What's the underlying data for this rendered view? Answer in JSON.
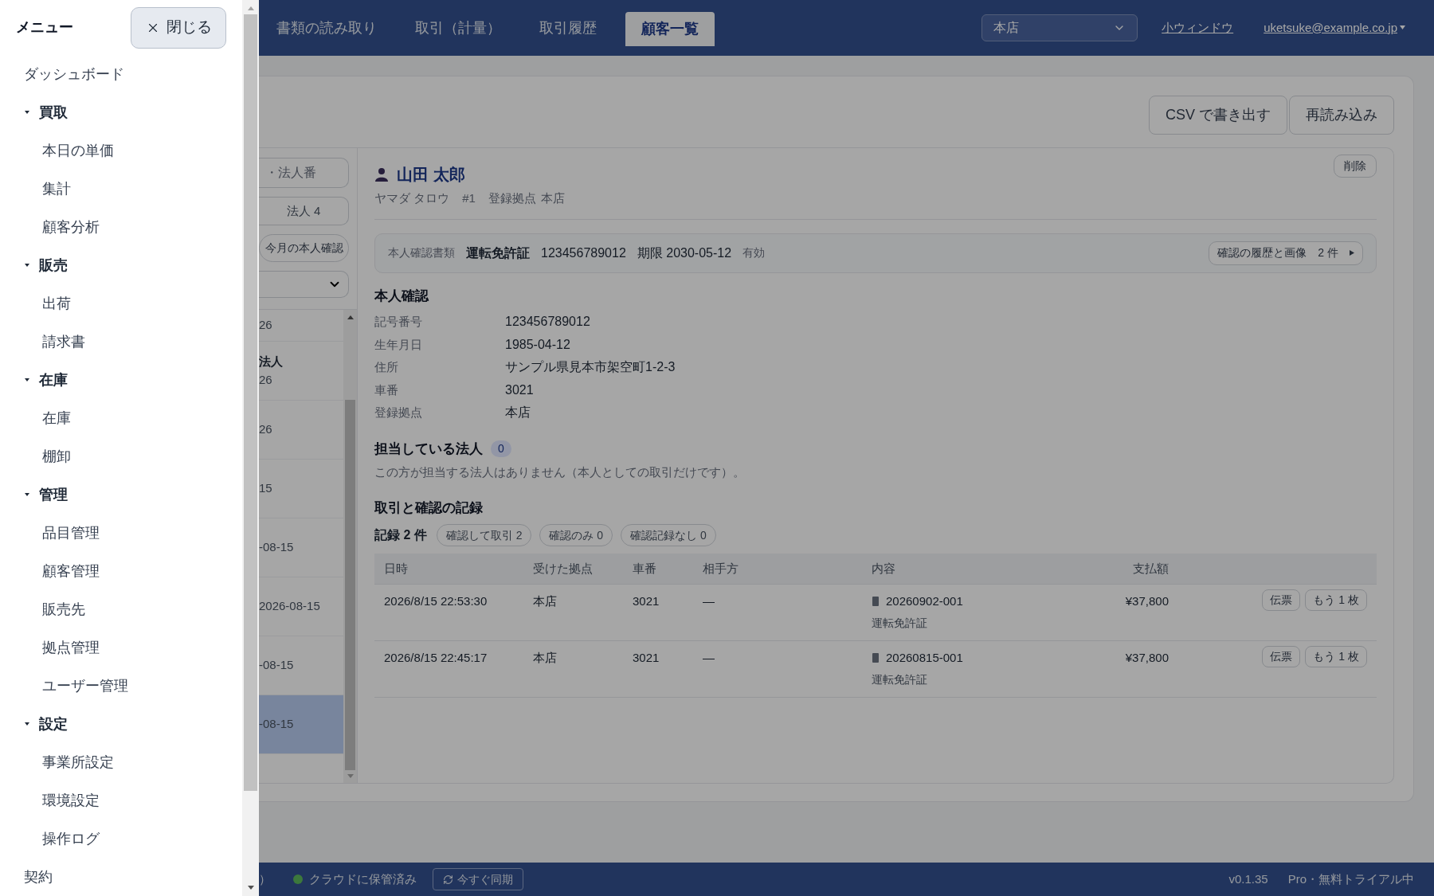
{
  "menu": {
    "title": "メニュー",
    "close_label": "閉じる",
    "items": [
      {
        "label": "ダッシュボード"
      },
      {
        "label": "買取",
        "expanded": true,
        "children": [
          {
            "label": "本日の単価"
          },
          {
            "label": "集計"
          },
          {
            "label": "顧客分析"
          }
        ]
      },
      {
        "label": "販売",
        "expanded": true,
        "children": [
          {
            "label": "出荷"
          },
          {
            "label": "請求書"
          }
        ]
      },
      {
        "label": "在庫",
        "expanded": true,
        "children": [
          {
            "label": "在庫"
          },
          {
            "label": "棚卸"
          }
        ]
      },
      {
        "label": "管理",
        "expanded": true,
        "children": [
          {
            "label": "品目管理"
          },
          {
            "label": "顧客管理"
          },
          {
            "label": "販売先"
          },
          {
            "label": "拠点管理"
          },
          {
            "label": "ユーザー管理"
          }
        ]
      },
      {
        "label": "設定",
        "expanded": true,
        "children": [
          {
            "label": "事業所設定"
          },
          {
            "label": "環境設定"
          },
          {
            "label": "操作ログ"
          }
        ]
      },
      {
        "label": "契約"
      }
    ]
  },
  "header": {
    "tabs": [
      {
        "label": "書類の読み取り",
        "selected": false
      },
      {
        "label": "取引（計量）",
        "selected": false
      },
      {
        "label": "取引履歴",
        "selected": false
      },
      {
        "label": "顧客一覧",
        "selected": true
      }
    ],
    "store_select": {
      "value": "本店"
    },
    "small_window_link": "小ウィンドウ",
    "account": "uketsuke@example.co.jp"
  },
  "toolbar": {
    "buttons": [
      "CSV で書き出す",
      "再読み込み"
    ]
  },
  "customer_list": {
    "search": {
      "placeholder": "・法人番"
    },
    "filter_button": "法人 4",
    "month_filter": "今月の本人確認",
    "rows": [
      {
        "date": "26",
        "selected": false
      },
      {
        "title": "法人",
        "date": "26",
        "selected": false
      },
      {
        "date": "26",
        "selected": false
      },
      {
        "date": "15",
        "selected": false
      },
      {
        "date": "-08-15",
        "selected": false
      },
      {
        "date": "2026-08-15",
        "selected": false
      },
      {
        "date": "-08-15",
        "selected": false
      },
      {
        "date": "-08-15",
        "selected": true
      }
    ]
  },
  "customer": {
    "name": "山田 太郎",
    "kana": "ヤマダ タロウ",
    "number": "#1",
    "branch_label": "登録拠点",
    "branch": "本店",
    "delete_button": "削除",
    "id_document": {
      "label": "本人確認書類",
      "type": "運転免許証",
      "number": "123456789012",
      "expiry": "期限 2030-05-12",
      "status": "有効",
      "history_button": "確認の履歴と画像",
      "history_count": "2 件"
    }
  },
  "identity": {
    "title": "本人確認",
    "fields": [
      {
        "label": "記号番号",
        "value": "123456789012"
      },
      {
        "label": "生年月日",
        "value": "1985-04-12"
      },
      {
        "label": "住所",
        "value": "サンプル県見本市架空町1-2-3"
      },
      {
        "label": "車番",
        "value": "3021"
      },
      {
        "label": "登録拠点",
        "value": "本店"
      }
    ]
  },
  "corporations": {
    "title": "担当している法人",
    "count": "0",
    "note": "この方が担当する法人はありません（本人としての取引だけです）。"
  },
  "records": {
    "title": "取引と確認の記録",
    "summary": "記録 2 件",
    "filters": [
      "確認して取引 2",
      "確認のみ 0",
      "確認記録なし 0"
    ],
    "table": {
      "columns": [
        "日時",
        "受けた拠点",
        "車番",
        "相手方",
        "内容",
        "支払額"
      ],
      "rows": [
        {
          "datetime": "2026/8/15 22:53:30",
          "branch": "本店",
          "car": "3021",
          "partner": "—",
          "slip": "20260902-001",
          "document": "運転免許証",
          "amount": "¥37,800",
          "actions": [
            "伝票",
            "もう 1 枚"
          ]
        },
        {
          "datetime": "2026/8/15 22:45:17",
          "branch": "本店",
          "car": "3021",
          "partner": "—",
          "slip": "20260815-001",
          "document": "運転免許証",
          "amount": "¥37,800",
          "actions": [
            "伝票",
            "もう 1 枚"
          ]
        }
      ]
    }
  },
  "status_bar": {
    "cut_text": "）",
    "sync_status": "クラウドに保管済み",
    "synced": true,
    "sync_button": "今すぐ同期",
    "version": "v0.1.35",
    "plan": "Pro・無料トライアル中"
  }
}
